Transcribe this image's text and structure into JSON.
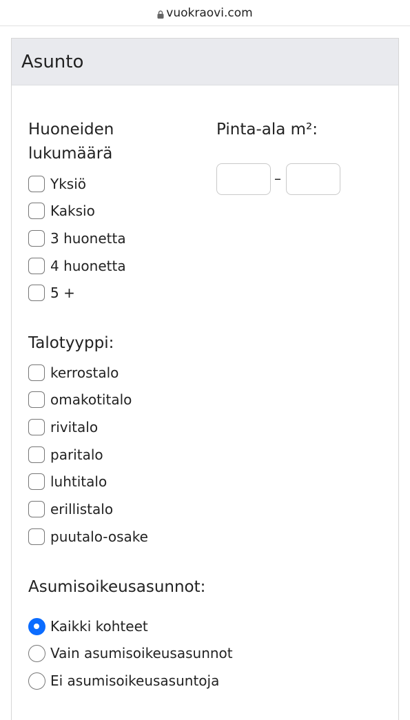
{
  "browser": {
    "url": "vuokraovi.com"
  },
  "panel": {
    "title": "Asunto"
  },
  "rooms": {
    "heading": "Huoneiden lukumäärä",
    "options": [
      "Yksiö",
      "Kaksio",
      "3 huonetta",
      "4 huonetta",
      "5 +"
    ]
  },
  "area": {
    "heading": "Pinta-ala m²:",
    "separator": "–",
    "min_value": "",
    "max_value": ""
  },
  "building_type": {
    "heading": "Talotyyppi:",
    "options": [
      "kerrostalo",
      "omakotitalo",
      "rivitalo",
      "paritalo",
      "luhtitalo",
      "erillistalo",
      "puutalo-osake"
    ]
  },
  "right_of_occupancy": {
    "heading": "Asumisoikeusasunnot:",
    "options": [
      "Kaikki kohteet",
      "Vain asumisoikeusasunnot",
      "Ei asumisoikeusasuntoja"
    ],
    "selected": "Kaikki kohteet"
  },
  "colors": {
    "accent": "#0b6cff",
    "header_bg": "#e9eaee"
  }
}
